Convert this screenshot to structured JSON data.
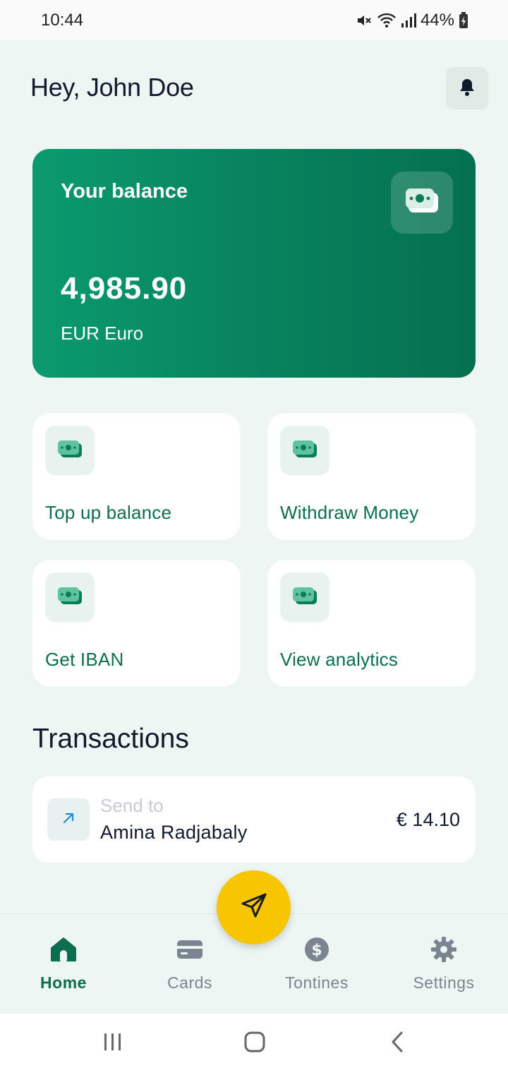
{
  "status_bar": {
    "time": "10:44",
    "battery": "44%",
    "icons": [
      "mute-icon",
      "wifi-icon",
      "signal-icon",
      "battery-icon"
    ]
  },
  "header": {
    "greeting": "Hey, John Doe",
    "bell_icon": "bell-icon"
  },
  "balance": {
    "label": "Your balance",
    "amount": "4,985.90",
    "currency": "EUR Euro",
    "icon": "money-icon"
  },
  "actions": [
    {
      "label": "Top up balance",
      "icon": "money-icon"
    },
    {
      "label": "Withdraw Money",
      "icon": "money-icon"
    },
    {
      "label": "Get IBAN",
      "icon": "money-icon"
    },
    {
      "label": "View analytics",
      "icon": "money-icon"
    }
  ],
  "transactions": {
    "title": "Transactions",
    "items": [
      {
        "type": "Send to",
        "name": "Amina Radjabaly",
        "amount": "€ 14.10",
        "icon": "arrow-up-right-icon"
      }
    ]
  },
  "fab": {
    "icon": "send-icon"
  },
  "bottom_nav": {
    "items": [
      {
        "label": "Home",
        "icon": "home-icon",
        "active": true
      },
      {
        "label": "Cards",
        "icon": "card-icon",
        "active": false
      },
      {
        "label": "Tontines",
        "icon": "dollar-icon",
        "active": false
      },
      {
        "label": "Settings",
        "icon": "gear-icon",
        "active": false
      }
    ]
  },
  "system_nav": {
    "icons": [
      "recents-icon",
      "home-circle-icon",
      "back-icon"
    ]
  },
  "colors": {
    "app_background": "#edf6f2",
    "brand_green": "#0a6e4f",
    "card_gradient_start": "#0b9a6e",
    "card_gradient_end": "#05704f",
    "fab_yellow": "#f7c600",
    "text_dark": "#0f1b2d",
    "nav_inactive": "#7a8591"
  }
}
